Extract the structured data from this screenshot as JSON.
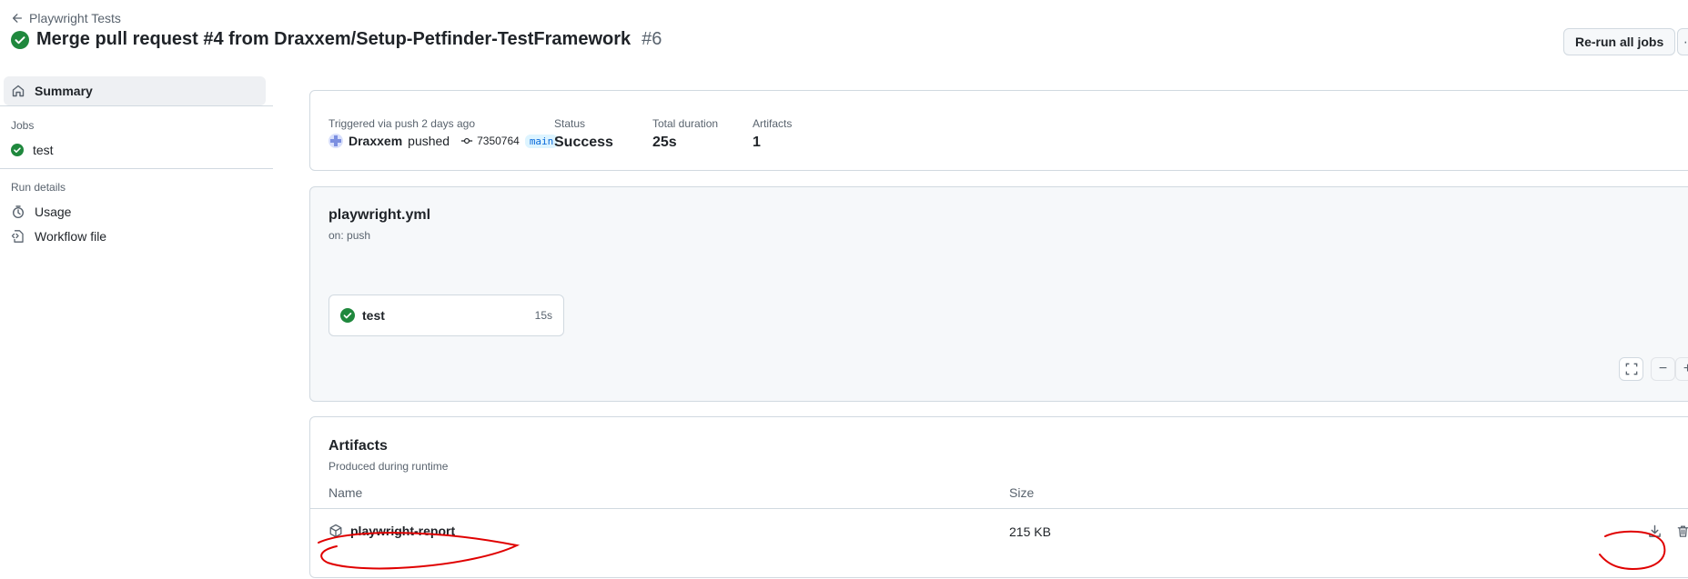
{
  "header": {
    "back_label": "Playwright Tests",
    "title": "Merge pull request #4 from Draxxem/Setup-Petfinder-TestFramework",
    "run_number": "#6",
    "rerun_label": "Re-run all jobs"
  },
  "sidebar": {
    "summary_label": "Summary",
    "jobs_heading": "Jobs",
    "jobs": [
      {
        "label": "test",
        "status": "success"
      }
    ],
    "run_details_heading": "Run details",
    "details": [
      {
        "label": "Usage",
        "icon": "stopwatch-icon"
      },
      {
        "label": "Workflow file",
        "icon": "file-code-icon"
      }
    ]
  },
  "summary": {
    "trigger_label": "Triggered via push 2 days ago",
    "actor": "Draxxem",
    "action": "pushed",
    "commit_sha": "7350764",
    "branch": "main",
    "status_label": "Status",
    "status_value": "Success",
    "duration_label": "Total duration",
    "duration_value": "25s",
    "artifacts_label": "Artifacts",
    "artifacts_value": "1"
  },
  "workflow": {
    "file": "playwright.yml",
    "trigger": "on: push",
    "job": {
      "name": "test",
      "duration": "15s"
    }
  },
  "artifacts": {
    "title": "Artifacts",
    "subtitle": "Produced during runtime",
    "columns": [
      "Name",
      "Size"
    ],
    "rows": [
      {
        "name": "playwright-report",
        "size": "215 KB"
      }
    ]
  },
  "colors": {
    "success": "#1f883d",
    "annotation": "#e00000",
    "branch_bg": "#ddf4ff",
    "branch_fg": "#0969da"
  }
}
